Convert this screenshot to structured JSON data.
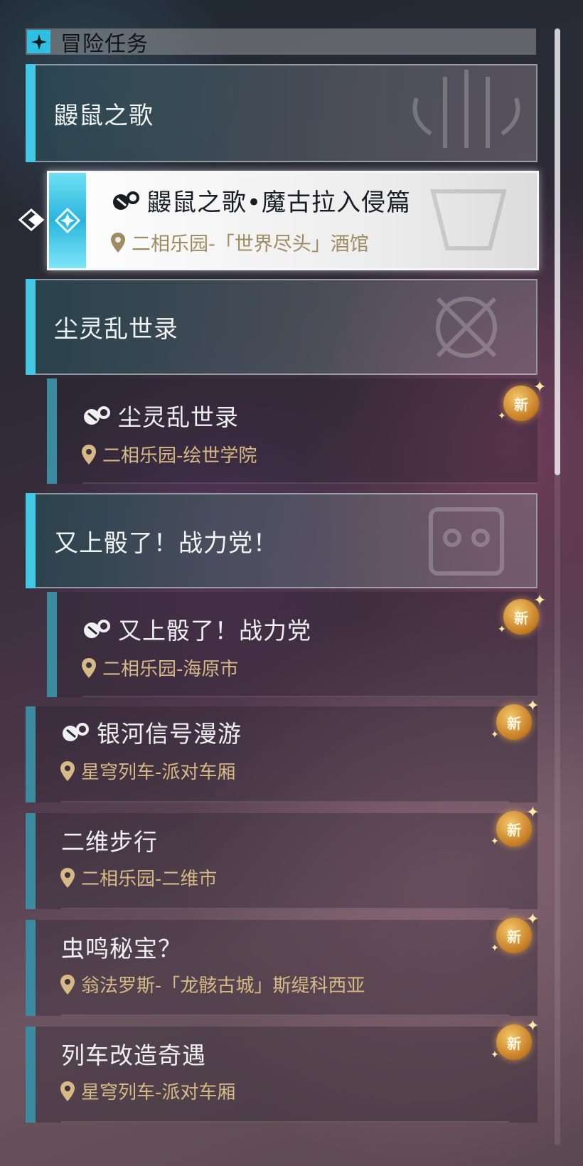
{
  "header": {
    "title": "冒险任务"
  },
  "colors": {
    "accent": "#43c8e4",
    "location": "#d7b986",
    "badge": "#e3a24a"
  },
  "groups": [
    {
      "title": "鼹鼠之歌"
    },
    {
      "title": "尘灵乱世录"
    },
    {
      "title": "又上骰了！战力党！"
    }
  ],
  "selected_quest": {
    "title": "鼹鼠之歌•魔古拉入侵篇",
    "location": "二相乐园-「世界尽头」酒馆"
  },
  "quests": [
    {
      "title": "尘灵乱世录",
      "location": "二相乐园-绘世学院",
      "badge": "新"
    },
    {
      "title": "又上骰了！战力党",
      "location": "二相乐园-海原市",
      "badge": "新"
    },
    {
      "title": "银河信号漫游",
      "location": "星穹列车-派对车厢",
      "badge": "新"
    },
    {
      "title": "二维步行",
      "location": "二相乐园-二维市",
      "badge": "新"
    },
    {
      "title": "虫鸣秘宝？",
      "location": "翁法罗斯-「龙骸古城」斯缇科西亚",
      "badge": "新"
    },
    {
      "title": "列车改造奇遇",
      "location": "星穹列车-派对车厢",
      "badge": "新"
    }
  ],
  "scroll": {
    "position_fraction": 0.0,
    "visible_fraction": 0.4
  }
}
